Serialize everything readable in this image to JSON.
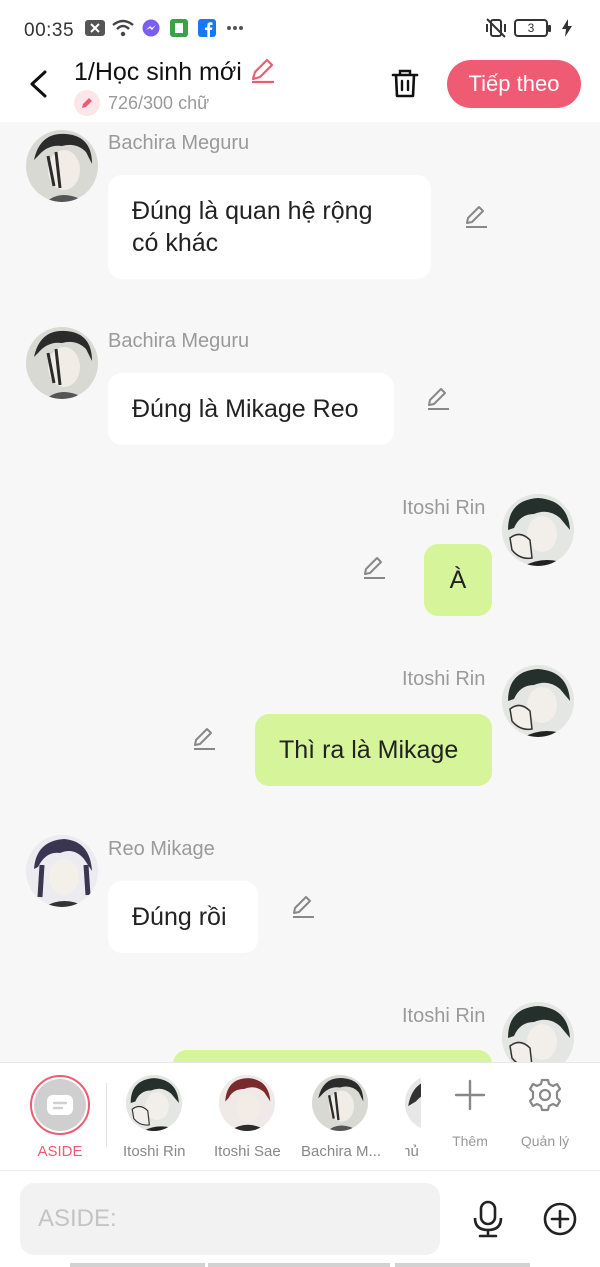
{
  "status_bar": {
    "time": "00:35",
    "battery": "3"
  },
  "header": {
    "title": "1/Học sinh mới",
    "word_count": "726/300 chữ",
    "next_label": "Tiếp theo"
  },
  "messages": [
    {
      "side": "left",
      "sender": "Bachira Meguru",
      "lines": [
        "Đúng là quan hệ rộng",
        "có khác"
      ]
    },
    {
      "side": "left",
      "sender": "Bachira Meguru",
      "lines": [
        "Đúng là Mikage Reo"
      ]
    },
    {
      "side": "right",
      "sender": "Itoshi Rin",
      "lines": [
        "À"
      ]
    },
    {
      "side": "right",
      "sender": "Itoshi Rin",
      "lines": [
        "Thì ra là Mikage"
      ]
    },
    {
      "side": "left",
      "sender": "Reo Mikage",
      "lines": [
        "Đúng rồi"
      ]
    },
    {
      "side": "right",
      "sender": "Itoshi Rin",
      "lines": [
        ""
      ]
    }
  ],
  "toolbar": {
    "aside_label": "ASIDE",
    "characters": [
      "Itoshi Rin",
      "Itoshi Sae",
      "Bachira M...",
      "Thủ"
    ],
    "add_label": "Thêm",
    "manage_label": "Quản lý"
  },
  "input": {
    "placeholder": "ASIDE:"
  },
  "colors": {
    "accent": "#ef5b73",
    "right_bubble": "#d6f59a",
    "left_bubble": "#ffffff",
    "background": "#f7f7f7"
  }
}
